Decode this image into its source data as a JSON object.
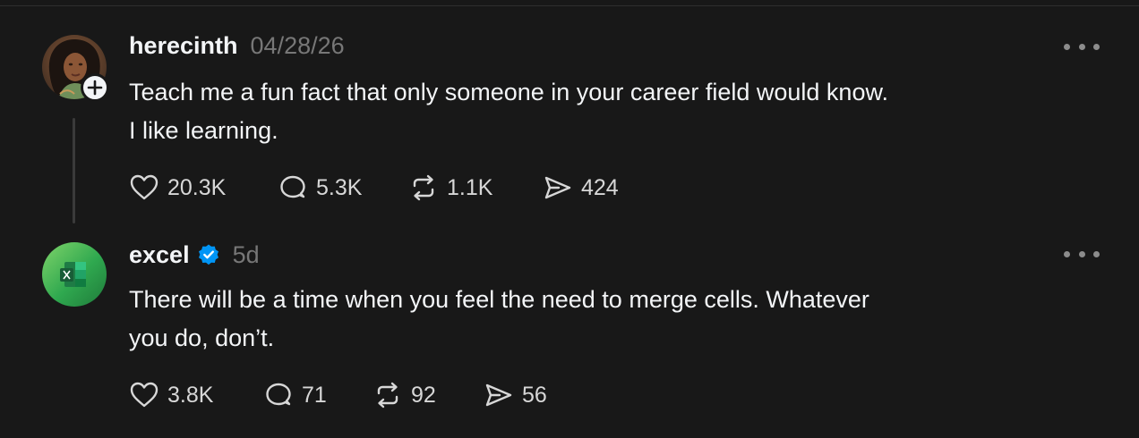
{
  "posts": [
    {
      "username": "herecinth",
      "timestamp": "04/28/26",
      "verified": false,
      "text_line1": "Teach me a fun fact that only someone in your career field would know.",
      "text_line2": "I like learning.",
      "likes": "20.3K",
      "replies": "5.3K",
      "reposts": "1.1K",
      "shares": "424"
    },
    {
      "username": "excel",
      "timestamp": "5d",
      "verified": true,
      "text_line1": "There will be a time when you feel the need to merge cells. Whatever",
      "text_line2": "you do, don’t.",
      "likes": "3.8K",
      "replies": "71",
      "reposts": "92",
      "shares": "56"
    }
  ],
  "colors": {
    "background": "#181818",
    "text_primary": "#f3f5f7",
    "text_secondary": "#777777",
    "verified_blue": "#0095f6",
    "excel_green": "#2fa84f"
  },
  "icons": [
    "heart-icon",
    "reply-icon",
    "repost-icon",
    "share-icon",
    "more-icon",
    "verified-badge-icon",
    "follow-plus-icon"
  ]
}
